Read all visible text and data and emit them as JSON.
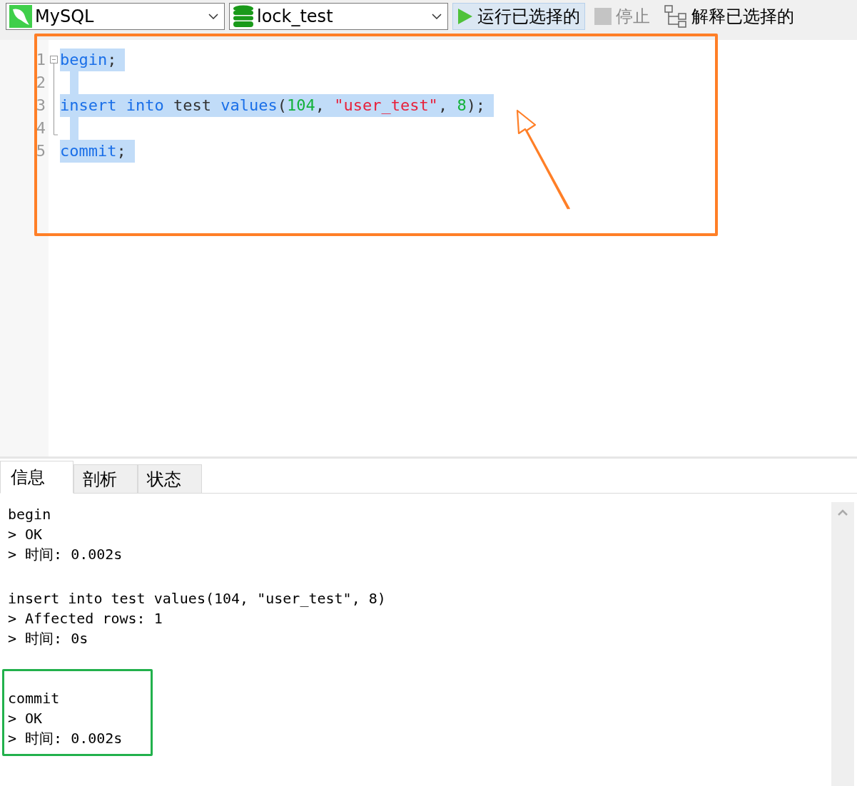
{
  "toolbar": {
    "connection_select": {
      "label": "MySQL"
    },
    "database_select": {
      "label": "lock_test"
    },
    "buttons": [
      {
        "kind": "run",
        "label": "运行已选择的",
        "highlighted": true,
        "disabled": false
      },
      {
        "kind": "stop",
        "label": "停止",
        "highlighted": false,
        "disabled": true
      },
      {
        "kind": "explain",
        "label": "解释已选择的",
        "highlighted": false,
        "disabled": false
      }
    ]
  },
  "editor": {
    "lines": [
      {
        "number": "1",
        "kind": "fold-start",
        "selected": true,
        "tokens": [
          {
            "kind": "keyword",
            "text": "begin"
          },
          {
            "kind": "plain",
            "text": ";"
          }
        ]
      },
      {
        "number": "2",
        "kind": "fold-inner",
        "selected": true
      },
      {
        "number": "3",
        "kind": "fold-inner",
        "selected": true,
        "tokens": [
          {
            "kind": "keyword",
            "text": "insert into"
          },
          {
            "kind": "plain",
            "text": " test "
          },
          {
            "kind": "keyword",
            "text": "values"
          },
          {
            "kind": "plain",
            "text": "("
          },
          {
            "kind": "number",
            "text": "104"
          },
          {
            "kind": "plain",
            "text": ", "
          },
          {
            "kind": "string",
            "text": "\"user_test\""
          },
          {
            "kind": "plain",
            "text": ", "
          },
          {
            "kind": "number",
            "text": "8"
          },
          {
            "kind": "plain",
            "text": ");"
          }
        ]
      },
      {
        "number": "4",
        "kind": "fold-end",
        "selected": true
      },
      {
        "number": "5",
        "kind": "plain",
        "selected": true,
        "tokens": [
          {
            "kind": "keyword",
            "text": "commit"
          },
          {
            "kind": "plain",
            "text": ";"
          }
        ]
      }
    ],
    "annotation": {
      "kind": "box-with-arrow",
      "color": "#ff7f27"
    }
  },
  "output": {
    "tabs": [
      {
        "label": "信息",
        "selected": true
      },
      {
        "label": "剖析",
        "selected": false
      },
      {
        "label": "状态",
        "selected": false
      }
    ],
    "groups": [
      {
        "highlighted": false,
        "lines": [
          "begin",
          "> OK",
          "> 时间: 0.002s"
        ]
      },
      {
        "highlighted": false,
        "lines": [
          "insert into test values(104, \"user_test\", 8)",
          "> Affected rows: 1",
          "> 时间: 0s"
        ]
      },
      {
        "highlighted": true,
        "color": "#22b14c",
        "lines": [
          "commit",
          "> OK",
          "> 时间: 0.002s"
        ]
      }
    ]
  }
}
